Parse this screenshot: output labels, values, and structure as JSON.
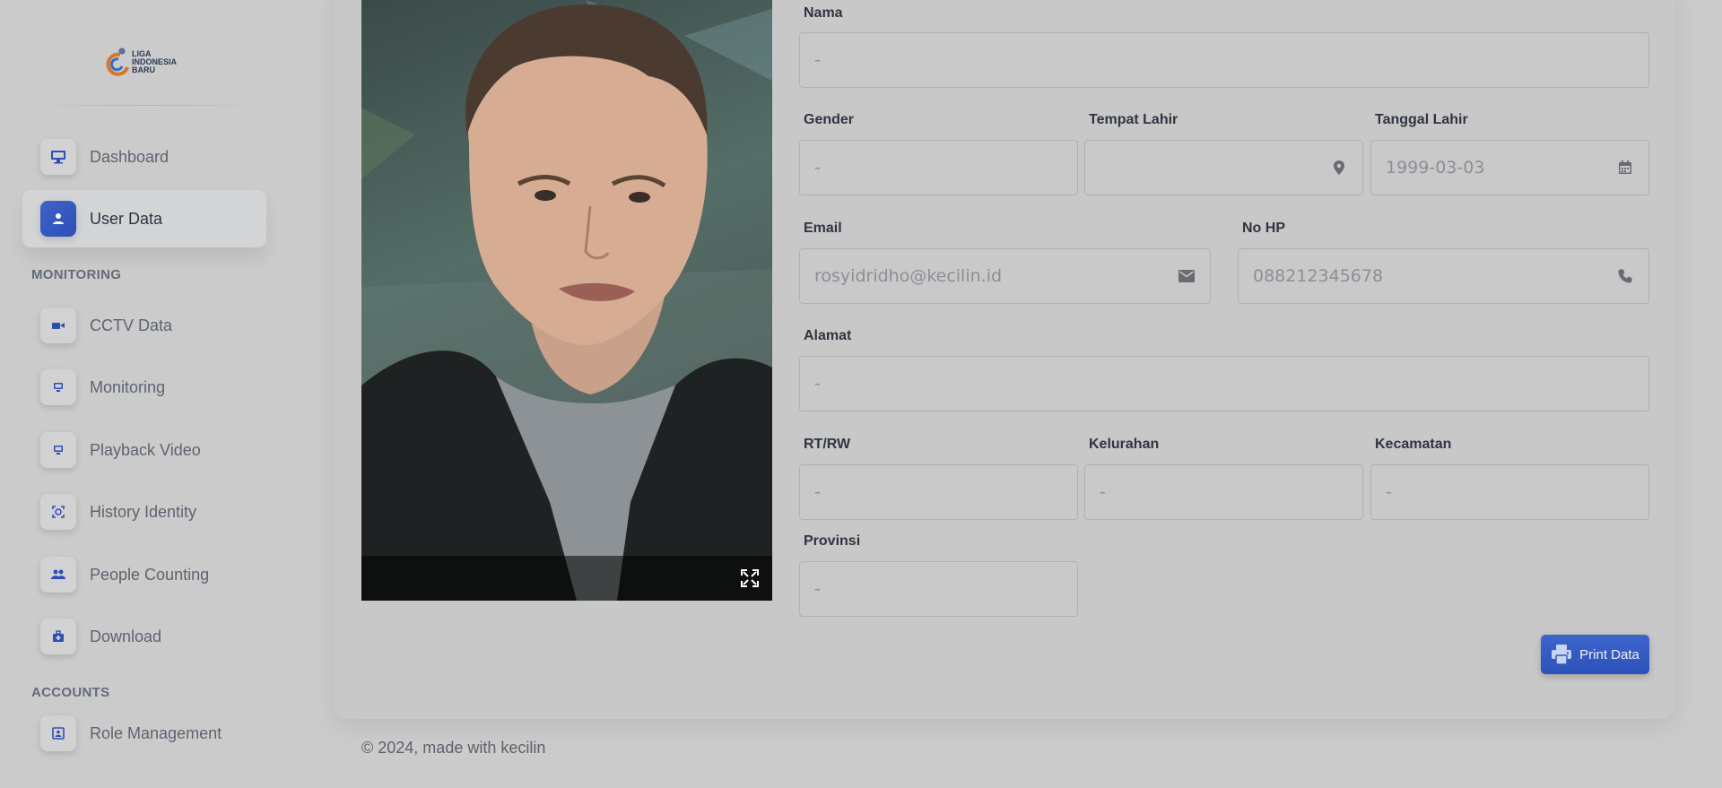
{
  "logo": {
    "line1": "LIGA",
    "line2": "INDONESIA",
    "line3": "BARU"
  },
  "sidebar": {
    "items": [
      {
        "label": "Dashboard",
        "icon": "monitor-icon"
      },
      {
        "label": "User Data",
        "icon": "user-icon",
        "active": true
      }
    ],
    "sections": [
      {
        "title": "MONITORING",
        "items": [
          {
            "label": "CCTV Data",
            "icon": "video-camera-icon"
          },
          {
            "label": "Monitoring",
            "icon": "screen-icon"
          },
          {
            "label": "Playback Video",
            "icon": "screen-icon"
          },
          {
            "label": "History Identity",
            "icon": "face-scan-icon"
          },
          {
            "label": "People Counting",
            "icon": "people-icon"
          },
          {
            "label": "Download",
            "icon": "download-box-icon"
          }
        ]
      },
      {
        "title": "ACCOUNTS",
        "items": [
          {
            "label": "Role Management",
            "icon": "id-card-icon"
          }
        ]
      }
    ]
  },
  "form": {
    "nama": {
      "label": "Nama",
      "value": "-"
    },
    "gender": {
      "label": "Gender",
      "value": "-"
    },
    "tempat_lahir": {
      "label": "Tempat Lahir",
      "value": ""
    },
    "tanggal_lahir": {
      "label": "Tanggal Lahir",
      "value": "1999-03-03"
    },
    "email": {
      "label": "Email",
      "value": "rosyidridho@kecilin.id"
    },
    "no_hp": {
      "label": "No HP",
      "value": "088212345678"
    },
    "alamat": {
      "label": "Alamat",
      "value": "-"
    },
    "rt_rw": {
      "label": "RT/RW",
      "value": "-"
    },
    "kelurahan": {
      "label": "Kelurahan",
      "value": "-"
    },
    "kecamatan": {
      "label": "Kecamatan",
      "value": "-"
    },
    "provinsi": {
      "label": "Provinsi",
      "value": "-"
    }
  },
  "actions": {
    "print_label": "Print Data"
  },
  "footer": {
    "text": "© 2024, made with kecilin"
  },
  "colors": {
    "accent": "#3558c0",
    "background": "#cbcbcb"
  }
}
